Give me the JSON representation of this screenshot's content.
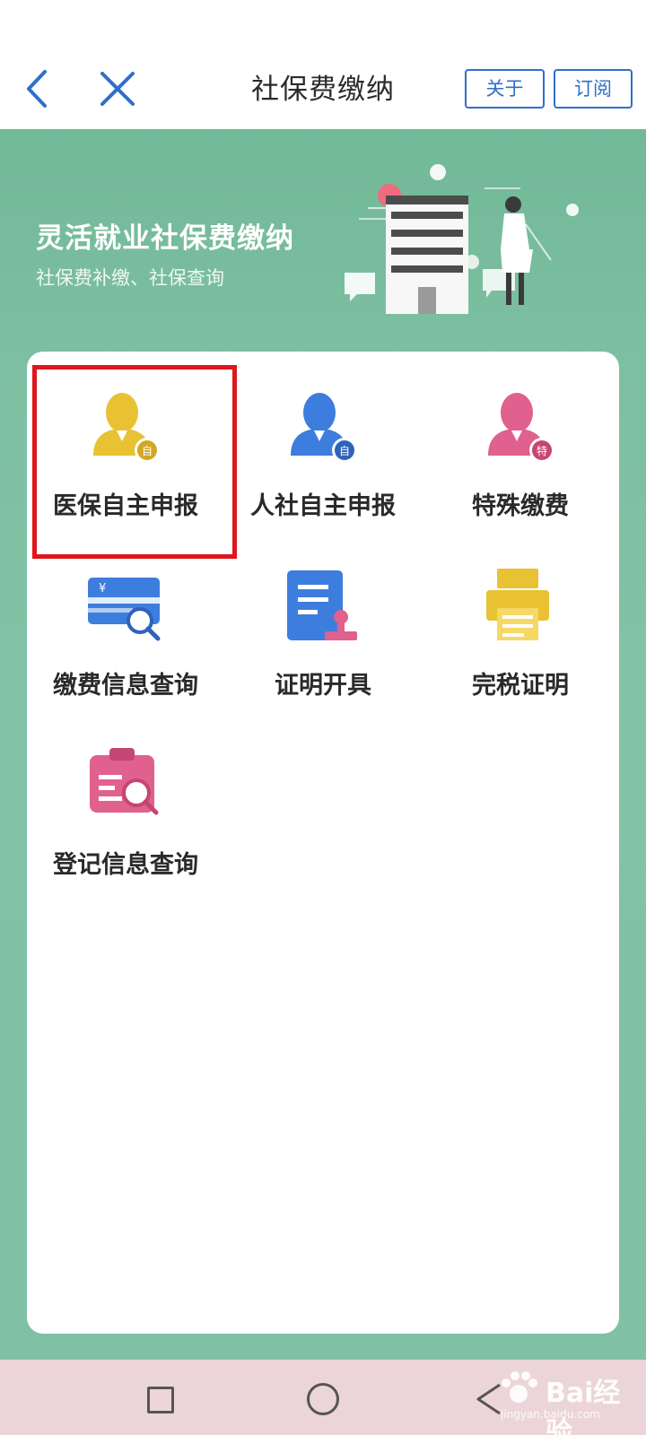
{
  "header": {
    "title": "社保费缴纳",
    "about_label": "关于",
    "subscribe_label": "订阅"
  },
  "banner": {
    "title": "灵活就业社保费缴纳",
    "subtitle": "社保费补缴、社保查询"
  },
  "grid": {
    "items": [
      {
        "label": "医保自主申报",
        "icon": "person-self-icon",
        "badge": "自",
        "color": "#e8c233"
      },
      {
        "label": "人社自主申报",
        "icon": "person-self-icon",
        "badge": "自",
        "color": "#3d7ddd"
      },
      {
        "label": "特殊缴费",
        "icon": "person-special-icon",
        "badge": "特",
        "color": "#e0608e"
      },
      {
        "label": "缴费信息查询",
        "icon": "card-search-icon",
        "badge": "¥",
        "color": "#3d7ddd"
      },
      {
        "label": "证明开具",
        "icon": "document-stamp-icon",
        "color": "#3d7ddd"
      },
      {
        "label": "完税证明",
        "icon": "printer-icon",
        "color": "#e8c233"
      },
      {
        "label": "登记信息查询",
        "icon": "clipboard-search-icon",
        "color": "#e0608e"
      }
    ],
    "highlighted_item": "医保自主申报"
  },
  "watermark": {
    "brand": "Bai",
    "brand_suffix": "经验",
    "url": "jingyan.baidu.com"
  },
  "colors": {
    "banner": "#7dbfa2",
    "accent": "#2f6fc9",
    "highlight_border": "#e0161d",
    "navbar": "#ecd5d8"
  }
}
